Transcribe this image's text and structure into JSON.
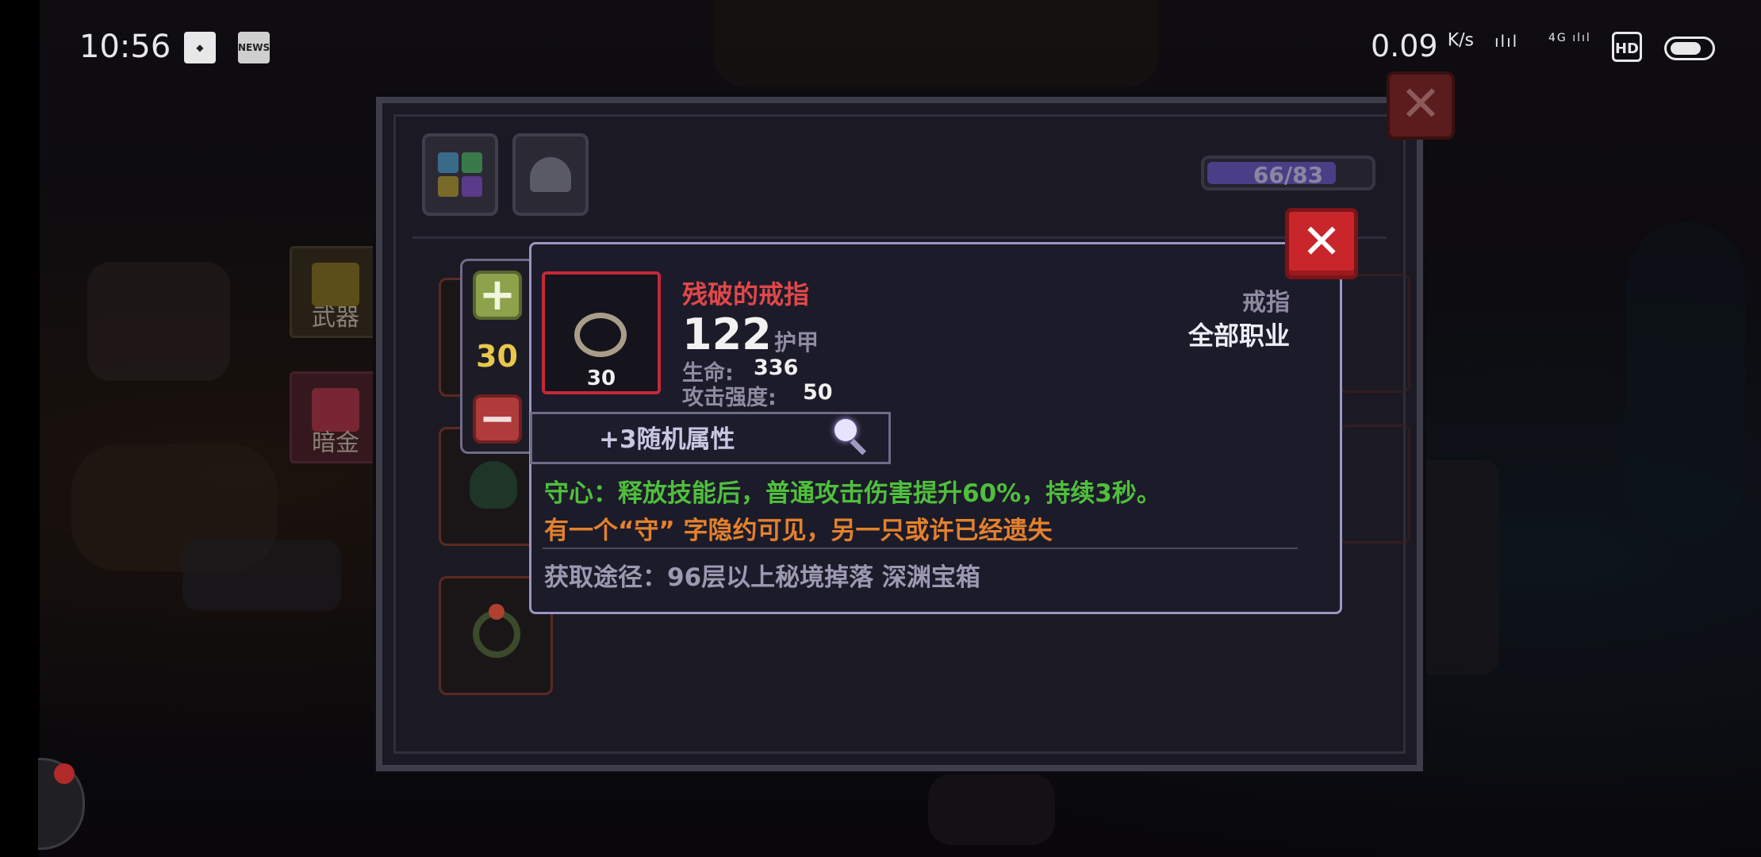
{
  "status_bar": {
    "time": "10:56",
    "qq_icon": "qq-penguin-icon",
    "news_icon_label": "NEWS",
    "speed_value": "0.09",
    "speed_unit": "K/s",
    "signal_1": "ᯤᯤᯤᯤ",
    "signal_2_label": "4G",
    "hd_label": "HD"
  },
  "bag": {
    "capacity": "66/83",
    "capacity_fraction": 0.795,
    "close_label": "✕",
    "tabs": [
      {
        "name": "all-items",
        "icon": "four-grid-icon"
      },
      {
        "name": "helmet",
        "icon": "helmet-icon"
      }
    ],
    "categories": [
      {
        "label": "武器",
        "icon": "weapon-icon"
      },
      {
        "label": "暗金",
        "icon": "dark-gold-icon"
      }
    ]
  },
  "stepper": {
    "plus_label": "+",
    "value": "30",
    "minus_label": "−"
  },
  "tooltip": {
    "close_label": "✕",
    "item_name": "残破的戒指",
    "item_level": "30",
    "armor_value": "122",
    "armor_label": "护甲",
    "stats": [
      {
        "label": "生命:",
        "value": "336"
      },
      {
        "label": "攻击强度:",
        "value": "50"
      }
    ],
    "item_type": "戒指",
    "item_class": "全部职业",
    "random_attr": "+3随机属性",
    "effect_text": "守心：释放技能后，普通攻击伤害提升60%，持续3秒。",
    "flavor_text": "有一个“守” 字隐约可见，另一只或许已经遗失",
    "source_text": "获取途径：96层以上秘境掉落 深渊宝箱"
  },
  "colors": {
    "item_name": "#e0484a",
    "effect": "#4fbf3c",
    "flavor": "#e3812d",
    "level": "#e8c84a",
    "border": "#9b95c4"
  }
}
